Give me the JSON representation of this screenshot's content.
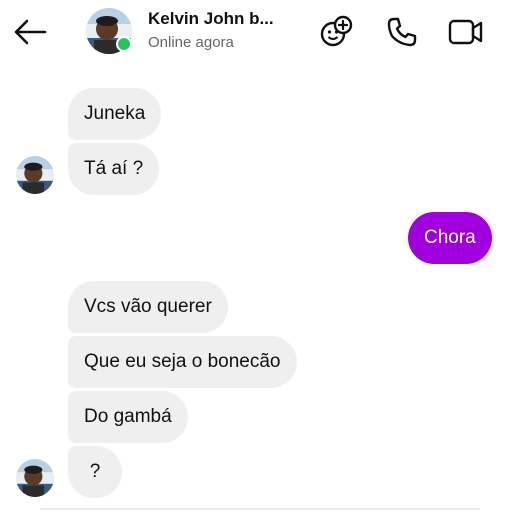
{
  "header": {
    "contact_name": "Kelvin John b...",
    "status": "Online agora",
    "icons": {
      "back": "arrow-left-icon",
      "effects": "effects-icon",
      "call": "phone-icon",
      "video": "video-camera-icon"
    }
  },
  "messages": {
    "incoming_1": "Juneka",
    "incoming_2": "Tá aí ?",
    "outgoing_1": "Chora",
    "incoming_3": "Vcs vão querer",
    "incoming_4": "Que eu seja o bonecão",
    "incoming_5": "Do gambá",
    "incoming_6": "?"
  },
  "colors": {
    "outgoing_bubble": "#a100de",
    "incoming_bubble": "#efefef",
    "online_indicator": "#22c55e"
  }
}
